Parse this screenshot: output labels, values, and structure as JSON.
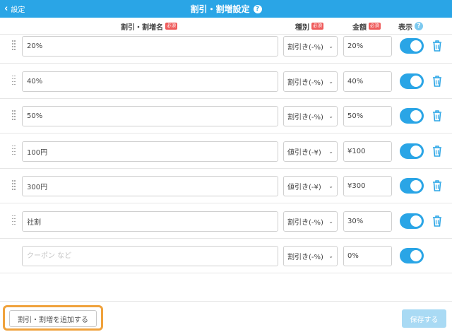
{
  "header": {
    "back_label": "設定",
    "title": "割引・割増設定",
    "help_icon": "?"
  },
  "columns": {
    "name": "割引・割増名",
    "type": "種別",
    "amount": "金額",
    "display": "表示",
    "required": "必須"
  },
  "rows": [
    {
      "name": "20%",
      "type": "割引き(-%)",
      "amount": "20%",
      "visible": true
    },
    {
      "name": "40%",
      "type": "割引き(-%)",
      "amount": "40%",
      "visible": true
    },
    {
      "name": "50%",
      "type": "割引き(-%)",
      "amount": "50%",
      "visible": true
    },
    {
      "name": "100円",
      "type": "値引き(-¥)",
      "amount": "¥100",
      "visible": true
    },
    {
      "name": "300円",
      "type": "値引き(-¥)",
      "amount": "¥300",
      "visible": true
    },
    {
      "name": "社割",
      "type": "割引き(-%)",
      "amount": "30%",
      "visible": true
    }
  ],
  "new_row": {
    "name_placeholder": "クーポン など",
    "type": "割引き(-%)",
    "amount": "0%",
    "visible": true
  },
  "footer": {
    "add_button": "割引・割増を追加する",
    "save_button": "保存する"
  },
  "colors": {
    "accent": "#2aa5e6",
    "highlight": "#f0a23c",
    "required_badge": "#ef5b5b",
    "save_disabled": "#a9daf4"
  }
}
